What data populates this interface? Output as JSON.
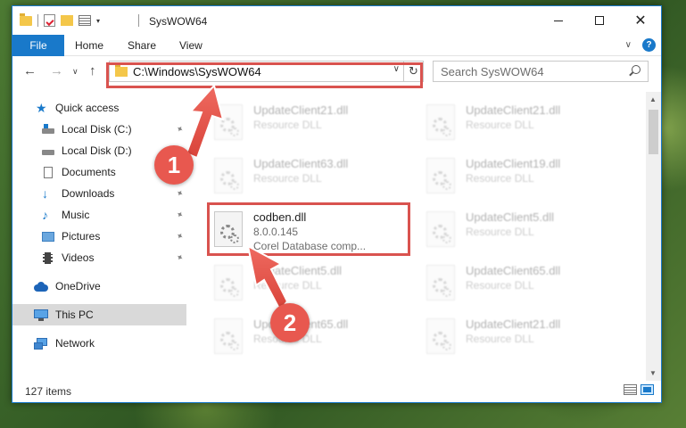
{
  "window": {
    "title": "SysWOW64",
    "accent": "#1979ca",
    "annotation_color": "#d9534f"
  },
  "ribbon": {
    "tabs": [
      "File",
      "Home",
      "Share",
      "View"
    ],
    "help_label": "?"
  },
  "nav": {
    "path": "C:\\Windows\\SysWOW64",
    "search_placeholder": "Search SysWOW64"
  },
  "sidebar": {
    "items": [
      {
        "label": "Quick access",
        "icon": "star-icon",
        "pinned": false
      },
      {
        "label": "Local Disk (C:)",
        "icon": "drive-icon",
        "pinned": true
      },
      {
        "label": "Local Disk (D:)",
        "icon": "drive-icon",
        "pinned": true
      },
      {
        "label": "Documents",
        "icon": "documents-icon",
        "pinned": true
      },
      {
        "label": "Downloads",
        "icon": "download-icon",
        "pinned": true
      },
      {
        "label": "Music",
        "icon": "music-icon",
        "pinned": true
      },
      {
        "label": "Pictures",
        "icon": "pictures-icon",
        "pinned": true
      },
      {
        "label": "Videos",
        "icon": "videos-icon",
        "pinned": true
      },
      {
        "label": "OneDrive",
        "icon": "cloud-icon",
        "pinned": false
      },
      {
        "label": "This PC",
        "icon": "computer-icon",
        "pinned": false,
        "selected": true
      },
      {
        "label": "Network",
        "icon": "network-icon",
        "pinned": false
      }
    ]
  },
  "files": {
    "left": [
      {
        "name": "UpdateClient21.dll",
        "type": "Resource DLL"
      },
      {
        "name": "UpdateClient63.dll",
        "type": "Resource DLL"
      },
      {
        "name": "codben.dll",
        "version": "8.0.0.145",
        "description": "Corel Database comp..."
      },
      {
        "name": "UpdateClient5.dll",
        "type": "Resource DLL"
      },
      {
        "name": "UpdateClient65.dll",
        "type": "Resource DLL"
      }
    ],
    "right": [
      {
        "name": "UpdateClient21.dll",
        "type": "Resource DLL"
      },
      {
        "name": "UpdateClient19.dll",
        "type": "Resource DLL"
      },
      {
        "name": "UpdateClient5.dll",
        "type": "Resource DLL"
      },
      {
        "name": "UpdateClient65.dll",
        "type": "Resource DLL"
      },
      {
        "name": "UpdateClient21.dll",
        "type": "Resource DLL"
      }
    ]
  },
  "status": {
    "item_count": "127 items"
  },
  "annotations": {
    "step1": "1",
    "step2": "2"
  }
}
